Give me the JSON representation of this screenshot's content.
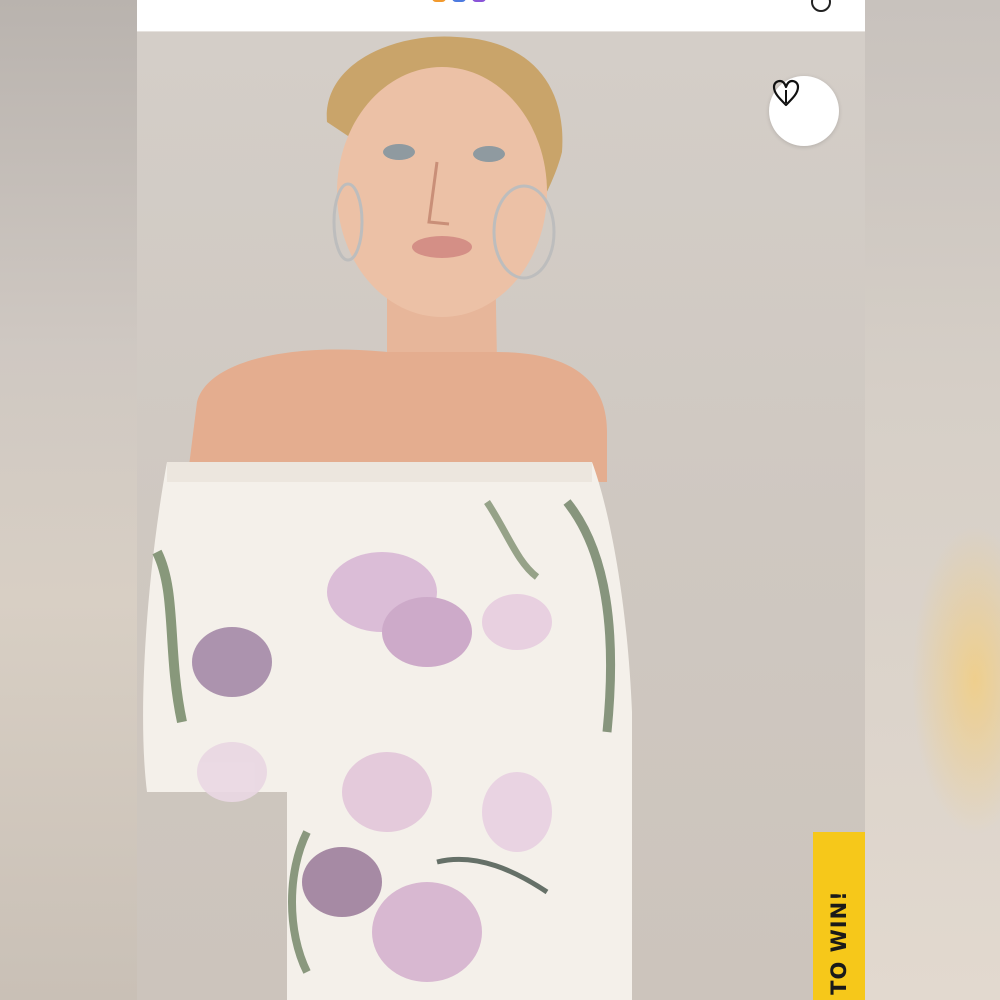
{
  "screen": {
    "background_colors": {
      "side": "#c9c3bd",
      "accent_yellow": "#f6c81a",
      "white": "#ffffff"
    }
  },
  "top_bar": {
    "logo_colors": [
      "#f29a2e",
      "#4d7be0",
      "#8a54d8"
    ],
    "account_icon": "account-icon"
  },
  "product_image": {
    "favorite_icon": "heart-icon"
  },
  "promo_tab": {
    "label": "N TO WIN!"
  }
}
